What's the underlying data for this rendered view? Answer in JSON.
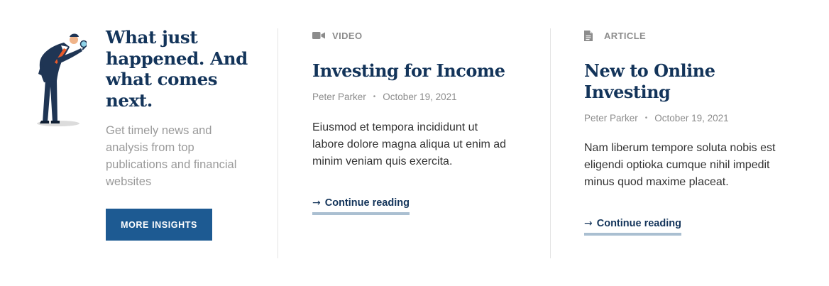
{
  "intro": {
    "title": "What just happened. And what comes next.",
    "description": "Get timely news and analysis from top publications and financial websites",
    "button_label": "MORE INSIGHTS"
  },
  "cards": [
    {
      "type_label": "VIDEO",
      "type_icon": "video-camera-icon",
      "title": "Investing for Income",
      "author": "Peter Parker",
      "separator": "•",
      "date": "October 19, 2021",
      "excerpt": "Eiusmod et tempora incididunt ut labore dolore magna aliqua ut enim ad minim veniam quis exercita.",
      "link_arrow": "→",
      "link_label": "Continue reading"
    },
    {
      "type_label": "ARTICLE",
      "type_icon": "document-icon",
      "title": "New to Online Investing",
      "author": "Peter Parker",
      "separator": "•",
      "date": "October 19, 2021",
      "excerpt": "Nam liberum tempore soluta nobis est eligendi optioka cumque nihil impedit minus quod maxime placeat.",
      "link_arrow": "→",
      "link_label": "Continue reading"
    }
  ],
  "colors": {
    "heading": "#13345a",
    "button": "#1d5a92",
    "muted": "#8c8c8c",
    "link_underline": "#aabfd1"
  }
}
